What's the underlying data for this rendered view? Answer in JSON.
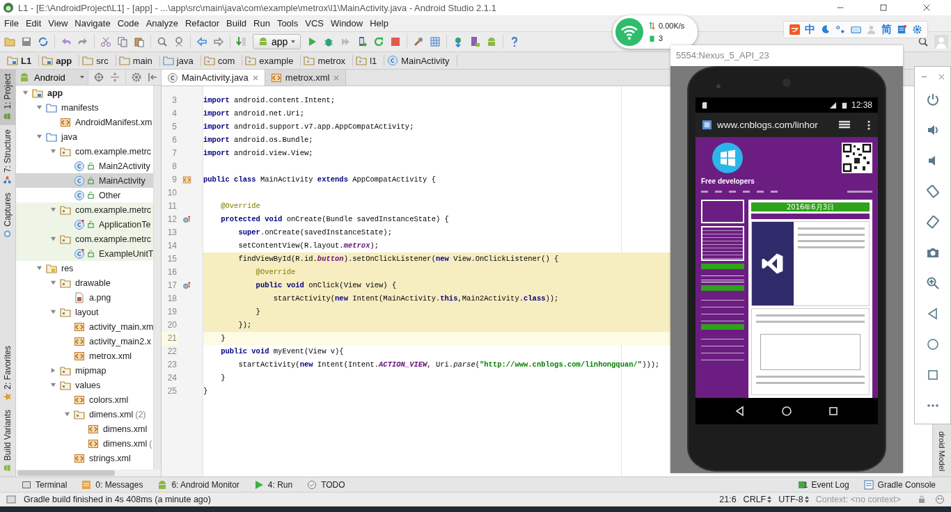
{
  "window": {
    "title": "L1 - [E:\\AndroidProject\\L1] - [app] - ...\\app\\src\\main\\java\\com\\example\\metrox\\l1\\MainActivity.java - Android Studio 2.1.1"
  },
  "menu": [
    "File",
    "Edit",
    "View",
    "Navigate",
    "Code",
    "Analyze",
    "Refactor",
    "Build",
    "Run",
    "Tools",
    "VCS",
    "Window",
    "Help"
  ],
  "toolbar": {
    "run_config": "app"
  },
  "breadcrumbs": [
    {
      "label": "L1",
      "kind": "module"
    },
    {
      "label": "app",
      "kind": "module"
    },
    {
      "label": "src",
      "kind": "folder"
    },
    {
      "label": "main",
      "kind": "folder"
    },
    {
      "label": "java",
      "kind": "source"
    },
    {
      "label": "com",
      "kind": "package"
    },
    {
      "label": "example",
      "kind": "package"
    },
    {
      "label": "metrox",
      "kind": "package"
    },
    {
      "label": "l1",
      "kind": "package"
    },
    {
      "label": "MainActivity",
      "kind": "class"
    }
  ],
  "left_strip_top": [
    {
      "label": "1: Project",
      "kind": "project",
      "selected": true
    },
    {
      "label": "7: Structure",
      "kind": "structure",
      "selected": false
    },
    {
      "label": "Captures",
      "kind": "captures",
      "selected": false
    }
  ],
  "left_strip_bottom": [
    {
      "label": "2: Favorites",
      "kind": "favorites",
      "selected": false
    },
    {
      "label": "Build Variants",
      "kind": "variants",
      "selected": false
    }
  ],
  "project": {
    "view": "Android",
    "tree": [
      {
        "label": "app",
        "kind": "module",
        "expanded": true,
        "selected": false,
        "children": [
          {
            "label": "manifests",
            "kind": "source",
            "expanded": true,
            "selected": false,
            "children": [
              {
                "label": "AndroidManifest.xm",
                "kind": "xml",
                "selected": false
              }
            ]
          },
          {
            "label": "java",
            "kind": "source",
            "expanded": true,
            "selected": false,
            "children": [
              {
                "label": "com.example.metrc",
                "kind": "package",
                "expanded": true,
                "selected": false,
                "test": false,
                "children": [
                  {
                    "label": "Main2Activity",
                    "kind": "class",
                    "selected": false
                  },
                  {
                    "label": "MainActivity",
                    "kind": "class",
                    "selected": true
                  },
                  {
                    "label": "Other",
                    "kind": "class",
                    "selected": false
                  }
                ]
              },
              {
                "label": "com.example.metrc",
                "kind": "package",
                "expanded": true,
                "selected": false,
                "test": true,
                "children": [
                  {
                    "label": "ApplicationTe",
                    "kind": "test-class",
                    "selected": false
                  }
                ]
              },
              {
                "label": "com.example.metrc",
                "kind": "package",
                "expanded": true,
                "selected": false,
                "test": true,
                "children": [
                  {
                    "label": "ExampleUnitT",
                    "kind": "test-class",
                    "selected": false
                  }
                ]
              }
            ]
          },
          {
            "label": "res",
            "kind": "res",
            "expanded": true,
            "selected": false,
            "children": [
              {
                "label": "drawable",
                "kind": "package",
                "expanded": true,
                "selected": false,
                "children": [
                  {
                    "label": "a.png",
                    "kind": "image",
                    "selected": false
                  }
                ]
              },
              {
                "label": "layout",
                "kind": "package",
                "expanded": true,
                "selected": false,
                "children": [
                  {
                    "label": "activity_main.xm",
                    "kind": "xml",
                    "selected": false
                  },
                  {
                    "label": "activity_main2.x",
                    "kind": "xml",
                    "selected": false
                  },
                  {
                    "label": "metrox.xml",
                    "kind": "xml",
                    "selected": false
                  }
                ]
              },
              {
                "label": "mipmap",
                "kind": "package",
                "expanded": false,
                "selected": false
              },
              {
                "label": "values",
                "kind": "package",
                "expanded": true,
                "selected": false,
                "children": [
                  {
                    "label": "colors.xml",
                    "kind": "xml",
                    "selected": false
                  },
                  {
                    "label": "dimens.xml",
                    "note": "(2)",
                    "kind": "package",
                    "expanded": true,
                    "selected": false,
                    "children": [
                      {
                        "label": "dimens.xml",
                        "kind": "xml",
                        "selected": false
                      },
                      {
                        "label": "dimens.xml",
                        "note": "(",
                        "kind": "xml",
                        "selected": false
                      }
                    ]
                  },
                  {
                    "label": "strings.xml",
                    "kind": "xml",
                    "selected": false
                  }
                ]
              }
            ]
          }
        ]
      }
    ]
  },
  "editor": {
    "tabs": [
      {
        "label": "MainActivity.java",
        "kind": "class",
        "selected": true
      },
      {
        "label": "metrox.xml",
        "kind": "xml",
        "selected": false
      }
    ],
    "lines": [
      {
        "number": "3",
        "highlight": false,
        "current": false,
        "kind": "plain",
        "tokens": [
          {
            "kind": "kw",
            "text": "import"
          },
          {
            "kind": "t",
            "text": " android.content.Intent;"
          }
        ]
      },
      {
        "number": "4",
        "highlight": false,
        "current": false,
        "kind": "plain",
        "tokens": [
          {
            "kind": "kw",
            "text": "import"
          },
          {
            "kind": "t",
            "text": " android.net.Uri;"
          }
        ]
      },
      {
        "number": "5",
        "highlight": false,
        "current": false,
        "kind": "plain",
        "tokens": [
          {
            "kind": "kw",
            "text": "import"
          },
          {
            "kind": "t",
            "text": " android.support.v7.app.AppCompatActivity;"
          }
        ]
      },
      {
        "number": "6",
        "highlight": false,
        "current": false,
        "kind": "plain",
        "tokens": [
          {
            "kind": "kw",
            "text": "import"
          },
          {
            "kind": "t",
            "text": " android.os.Bundle;"
          }
        ]
      },
      {
        "number": "7",
        "highlight": false,
        "current": false,
        "kind": "plain",
        "tokens": [
          {
            "kind": "kw",
            "text": "import"
          },
          {
            "kind": "t",
            "text": " android.view.View;"
          }
        ]
      },
      {
        "number": "8",
        "highlight": false,
        "current": false,
        "kind": "plain"
      },
      {
        "number": "9",
        "highlight": false,
        "current": false,
        "kind": "layout",
        "tokens": [
          {
            "kind": "kw",
            "text": "public class"
          },
          {
            "kind": "t",
            "text": " MainActivity "
          },
          {
            "kind": "kw",
            "text": "extends"
          },
          {
            "kind": "t",
            "text": " AppCompatActivity {"
          }
        ]
      },
      {
        "number": "10",
        "highlight": false,
        "current": false,
        "kind": "plain"
      },
      {
        "number": "11",
        "highlight": false,
        "current": false,
        "kind": "plain",
        "tokens": [
          {
            "kind": "annot",
            "text": "    @Override"
          }
        ]
      },
      {
        "number": "12",
        "highlight": false,
        "current": false,
        "kind": "override",
        "tokens": [
          {
            "kind": "kw",
            "text": "    protected void"
          },
          {
            "kind": "t",
            "text": " onCreate(Bundle savedInstanceState) {"
          }
        ]
      },
      {
        "number": "13",
        "highlight": false,
        "current": false,
        "kind": "plain",
        "tokens": [
          {
            "kind": "kw",
            "text": "        super"
          },
          {
            "kind": "t",
            "text": ".onCreate(savedInstanceState);"
          }
        ]
      },
      {
        "number": "14",
        "highlight": false,
        "current": false,
        "kind": "plain",
        "tokens": [
          {
            "kind": "t",
            "text": "        setContentView(R.layout."
          },
          {
            "kind": "field",
            "text": "metrox"
          },
          {
            "kind": "t",
            "text": ");"
          }
        ]
      },
      {
        "number": "15",
        "highlight": true,
        "current": false,
        "kind": "plain",
        "tokens": [
          {
            "kind": "t",
            "text": "        findViewById(R.id."
          },
          {
            "kind": "field",
            "text": "button"
          },
          {
            "kind": "t",
            "text": ").setOnClickListener("
          },
          {
            "kind": "kw",
            "text": "new"
          },
          {
            "kind": "t",
            "text": " View.OnClickListener() {"
          }
        ]
      },
      {
        "number": "16",
        "highlight": true,
        "current": false,
        "kind": "plain",
        "tokens": [
          {
            "kind": "annot",
            "text": "            @Override"
          }
        ]
      },
      {
        "number": "17",
        "highlight": true,
        "current": false,
        "kind": "override",
        "tokens": [
          {
            "kind": "kw",
            "text": "            public void"
          },
          {
            "kind": "t",
            "text": " onClick(View view) {"
          }
        ]
      },
      {
        "number": "18",
        "highlight": true,
        "current": false,
        "kind": "plain",
        "tokens": [
          {
            "kind": "t",
            "text": "                startActivity("
          },
          {
            "kind": "kw",
            "text": "new"
          },
          {
            "kind": "t",
            "text": " Intent(MainActivity."
          },
          {
            "kind": "kw",
            "text": "this"
          },
          {
            "kind": "t",
            "text": ",Main2Activity."
          },
          {
            "kind": "kw",
            "text": "class"
          },
          {
            "kind": "t",
            "text": "));"
          }
        ]
      },
      {
        "number": "19",
        "highlight": true,
        "current": false,
        "kind": "plain",
        "tokens": [
          {
            "kind": "t",
            "text": "            }"
          }
        ]
      },
      {
        "number": "20",
        "highlight": true,
        "current": false,
        "kind": "plain",
        "tokens": [
          {
            "kind": "t",
            "text": "        });"
          }
        ]
      },
      {
        "number": "21",
        "highlight": false,
        "current": true,
        "kind": "plain",
        "tokens": [
          {
            "kind": "t",
            "text": "    }"
          }
        ]
      },
      {
        "number": "22",
        "highlight": false,
        "current": false,
        "kind": "plain",
        "tokens": [
          {
            "kind": "kw",
            "text": "    public void"
          },
          {
            "kind": "t",
            "text": " myEvent(View v){"
          }
        ]
      },
      {
        "number": "23",
        "highlight": false,
        "current": false,
        "kind": "plain",
        "tokens": [
          {
            "kind": "t",
            "text": "        startActivity("
          },
          {
            "kind": "kw",
            "text": "new"
          },
          {
            "kind": "t",
            "text": " Intent(Intent."
          },
          {
            "kind": "static",
            "text": "ACTION_VIEW"
          },
          {
            "kind": "t",
            "text": ", Uri."
          },
          {
            "kind": "italic",
            "text": "parse"
          },
          {
            "kind": "t",
            "text": "("
          },
          {
            "kind": "str",
            "text": "\"http://www.cnblogs.com/linhongquan/\""
          },
          {
            "kind": "t",
            "text": ")));"
          }
        ]
      },
      {
        "number": "24",
        "highlight": false,
        "current": false,
        "kind": "plain",
        "tokens": [
          {
            "kind": "t",
            "text": "    }"
          }
        ]
      },
      {
        "number": "25",
        "highlight": false,
        "current": false,
        "kind": "plain",
        "tokens": [
          {
            "kind": "t",
            "text": "}"
          }
        ]
      }
    ]
  },
  "right_strip": {
    "label": "droid Model"
  },
  "bottom_tools": [
    {
      "label": "Terminal",
      "kind": "terminal"
    },
    {
      "label": "0: Messages",
      "kind": "messages"
    },
    {
      "label": "6: Android Monitor",
      "kind": "android"
    },
    {
      "label": "4: Run",
      "kind": "run"
    },
    {
      "label": "TODO",
      "kind": "todo"
    }
  ],
  "bottom_tools_right": [
    {
      "label": "Event Log",
      "kind": "event-log",
      "badge": "1"
    },
    {
      "label": "Gradle Console",
      "kind": "console"
    }
  ],
  "status_bar": {
    "message": "Gradle build finished in 4s 408ms (a minute ago)",
    "position": "21:6",
    "line_separator": "CRLF",
    "encoding": "UTF-8",
    "context": "Context: <no context>"
  },
  "network_widget": {
    "speed": "0.00K/s",
    "count": "3"
  },
  "ime_bar": {
    "mode": "中",
    "script": "简"
  },
  "emulator": {
    "title": "5554:Nexus_5_API_23",
    "time": "12:38",
    "url": "www.cnblogs.com/linhor",
    "site_title": "Free developers",
    "post_date": "2016年6月3日"
  }
}
